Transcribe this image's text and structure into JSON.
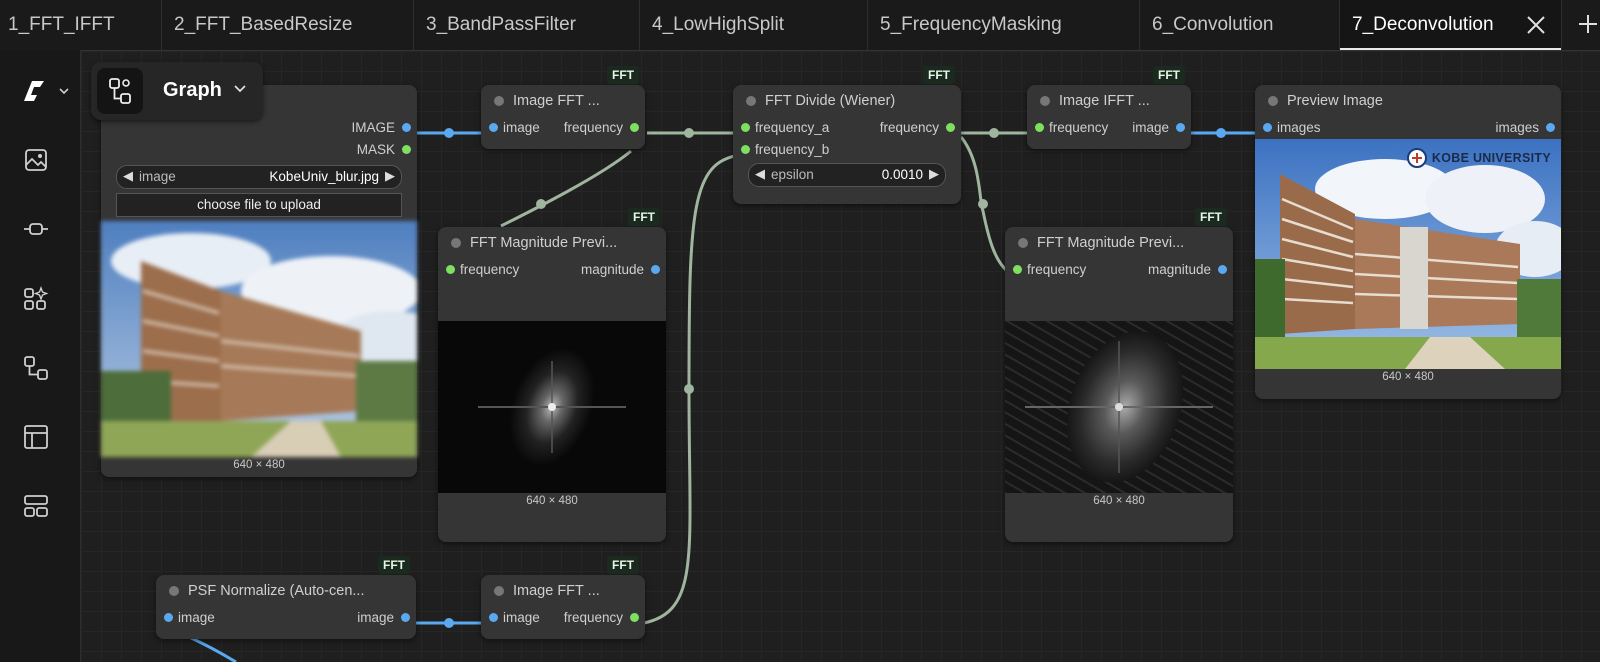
{
  "tabs": [
    {
      "label": "1_FFT_IFFT",
      "active": false
    },
    {
      "label": "2_FFT_BasedResize",
      "active": false
    },
    {
      "label": "3_BandPassFilter",
      "active": false
    },
    {
      "label": "4_LowHighSplit",
      "active": false
    },
    {
      "label": "5_FrequencyMasking",
      "active": false
    },
    {
      "label": "6_Convolution",
      "active": false
    },
    {
      "label": "7_Deconvolution",
      "active": true
    }
  ],
  "sidebar": [
    "logo-icon",
    "images-icon",
    "nodes-icon",
    "templates-icon",
    "workflows-icon",
    "layout-icon",
    "panels-icon"
  ],
  "graph_menu": {
    "label": "Graph"
  },
  "badge": "FFT",
  "nodes": {
    "load_image": {
      "outputs": [
        "IMAGE",
        "MASK"
      ],
      "widget_label": "image",
      "widget_value": "KobeUniv_blur.jpg",
      "upload_label": "choose file to upload",
      "caption": "640 × 480"
    },
    "image_fft_top": {
      "title": "Image FFT ...",
      "input": "image",
      "output": "frequency"
    },
    "fft_mag_left": {
      "title": "FFT Magnitude Previ...",
      "input": "frequency",
      "output": "magnitude",
      "caption": "640 × 480"
    },
    "fft_divide": {
      "title": "FFT Divide (Wiener)",
      "inputs": [
        "frequency_a",
        "frequency_b"
      ],
      "output": "frequency",
      "widget_label": "epsilon",
      "widget_value": "0.0010"
    },
    "image_ifft": {
      "title": "Image IFFT ...",
      "input": "frequency",
      "output": "image"
    },
    "fft_mag_right": {
      "title": "FFT Magnitude Previ...",
      "input": "frequency",
      "output": "magnitude",
      "caption": "640 × 480"
    },
    "preview_image": {
      "title": "Preview Image",
      "input": "images",
      "output": "images",
      "caption": "640 × 480",
      "watermark": "KOBE UNIVERSITY"
    },
    "psf_normalize": {
      "title": "PSF Normalize (Auto-cen...",
      "input": "image",
      "output": "image"
    },
    "image_fft_bottom": {
      "title": "Image FFT ...",
      "input": "image",
      "output": "frequency"
    }
  },
  "colors": {
    "frequency_link": "#9fb59f",
    "image_link": "#5aa9f0",
    "frequency_port": "#7ee05e",
    "image_port": "#5aa9f0"
  }
}
